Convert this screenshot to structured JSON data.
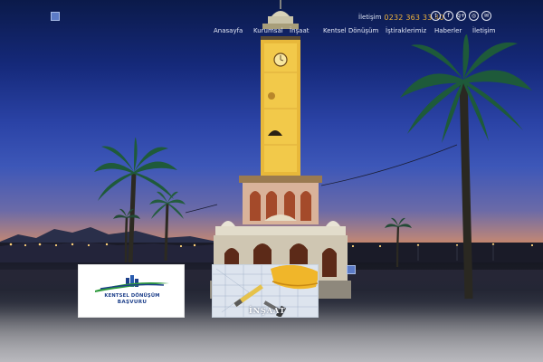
{
  "header": {
    "contact_label": "İletişim",
    "phone": "0232 363 33 40",
    "social_icons": [
      {
        "name": "twitter-icon",
        "glyph": "t"
      },
      {
        "name": "facebook-icon",
        "glyph": "f"
      },
      {
        "name": "google-plus-icon",
        "glyph": "g+"
      },
      {
        "name": "instagram-icon",
        "glyph": "◎"
      },
      {
        "name": "email-icon",
        "glyph": "✉"
      }
    ]
  },
  "nav": {
    "items": [
      {
        "label": "Anasayfa"
      },
      {
        "label": "Kurumsal"
      },
      {
        "label": "İnşaat"
      },
      {
        "label": "Kentsel Dönüşüm"
      },
      {
        "label": "İştiraklerimiz"
      },
      {
        "label": "Haberler"
      },
      {
        "label": "İletişim"
      }
    ]
  },
  "cards": {
    "kentsel": {
      "title": "KENTSEL DÖNÜŞÜM",
      "subtitle": "BAŞVURU"
    },
    "insaat": {
      "title": "İNŞAAT"
    }
  },
  "colors": {
    "phone": "#f0b33a",
    "brand_blue": "#1d3f8a",
    "brand_green": "#2e9a3c",
    "tower_gold": "#e8b83a"
  }
}
